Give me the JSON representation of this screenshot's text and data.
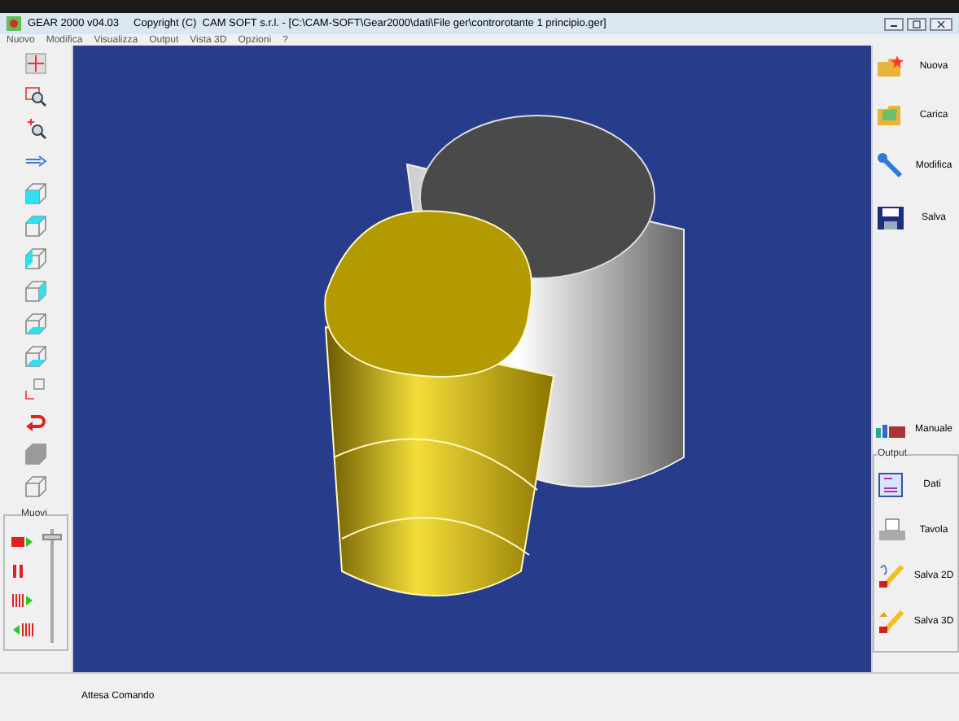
{
  "window": {
    "title": "GEAR 2000 v04.03     Copyright (C)  CAM SOFT s.r.l. - [C:\\CAM-SOFT\\Gear2000\\dati\\File ger\\controrotante 1 principio.ger]"
  },
  "menu": [
    "Nuovo",
    "Modifica",
    "Visualizza",
    "Output",
    "Vista 3D",
    "Opzioni",
    "?"
  ],
  "move_group": {
    "title": "Muovi",
    "slider": {
      "level": 0.95
    }
  },
  "file_buttons": [
    "Nuova",
    "Carica",
    "Modifica",
    "Salva"
  ],
  "manual_button": "Manuale",
  "output_group": {
    "title": "Output",
    "buttons": [
      "Dati",
      "Tavola",
      "Salva 2D",
      "Salva 3D"
    ]
  },
  "status_bar": "Attesa Comando"
}
